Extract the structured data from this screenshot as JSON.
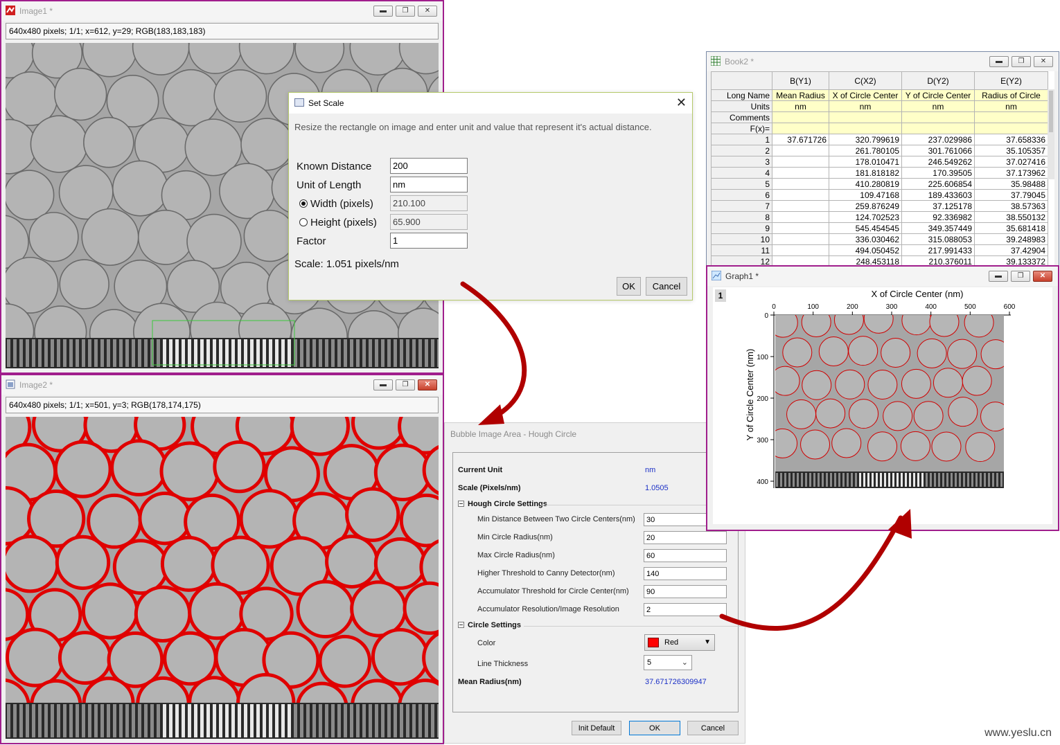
{
  "image1": {
    "title": "Image1 *",
    "status": "640x480 pixels; 1/1; x=612, y=29; RGB(183,183,183)"
  },
  "image2": {
    "title": "Image2 *",
    "status": "640x480 pixels; 1/1; x=501, y=3; RGB(178,174,175)"
  },
  "set_scale": {
    "title": "Set Scale",
    "description": "Resize the rectangle on image and enter unit and value that represent it's actual distance.",
    "known_distance_label": "Known Distance",
    "known_distance_value": "200",
    "unit_label": "Unit of Length",
    "unit_value": "nm",
    "width_label": "Width (pixels)",
    "width_value": "210.100",
    "width_selected": true,
    "height_label": "Height (pixels)",
    "height_value": "65.900",
    "factor_label": "Factor",
    "factor_value": "1",
    "scale_text": "Scale:  1.051 pixels/nm",
    "ok_label": "OK",
    "cancel_label": "Cancel"
  },
  "book": {
    "title": "Book2 *",
    "columns": [
      "B(Y1)",
      "C(X2)",
      "D(Y2)",
      "E(Y2)"
    ],
    "meta_rows": [
      {
        "label": "Long Name",
        "values": [
          "Mean Radius",
          "X of Circle Center",
          "Y of Circle Center",
          "Radius of Circle"
        ]
      },
      {
        "label": "Units",
        "values": [
          "nm",
          "nm",
          "nm",
          "nm"
        ]
      },
      {
        "label": "Comments",
        "values": [
          "",
          "",
          "",
          ""
        ]
      },
      {
        "label": "F(x)=",
        "values": [
          "",
          "",
          "",
          ""
        ]
      }
    ],
    "rows": [
      [
        "1",
        "37.671726",
        "320.799619",
        "237.029986",
        "37.658336"
      ],
      [
        "2",
        "",
        "261.780105",
        "301.761066",
        "35.105357"
      ],
      [
        "3",
        "",
        "178.010471",
        "246.549262",
        "37.027416"
      ],
      [
        "4",
        "",
        "181.818182",
        "170.39505",
        "37.173962"
      ],
      [
        "5",
        "",
        "410.280819",
        "225.606854",
        "35.98488"
      ],
      [
        "6",
        "",
        "109.47168",
        "189.433603",
        "37.79045"
      ],
      [
        "7",
        "",
        "259.876249",
        "37.125178",
        "38.57363"
      ],
      [
        "8",
        "",
        "124.702523",
        "92.336982",
        "38.550132"
      ],
      [
        "9",
        "",
        "545.454545",
        "349.357449",
        "35.681418"
      ],
      [
        "10",
        "",
        "336.030462",
        "315.088053",
        "39.248983"
      ],
      [
        "11",
        "",
        "494.050452",
        "217.991433",
        "37.42904"
      ],
      [
        "12",
        "",
        "248.453118",
        "210.376011",
        "39.133372"
      ]
    ]
  },
  "hough": {
    "title": "Bubble Image Area - Hough Circle",
    "current_unit_label": "Current Unit",
    "current_unit_value": "nm",
    "scale_label": "Scale (Pixels/nm)",
    "scale_value": "1.0505",
    "section1": "Hough Circle Settings",
    "fields": [
      {
        "label": "Min Distance Between Two Circle Centers(nm)",
        "value": "30"
      },
      {
        "label": "Min Circle Radius(nm)",
        "value": "20"
      },
      {
        "label": "Max Circle Radius(nm)",
        "value": "60"
      },
      {
        "label": "Higher Threshold to Canny Detector(nm)",
        "value": "140"
      },
      {
        "label": "Accumulator Threshold for Circle Center(nm)",
        "value": "90"
      },
      {
        "label": "Accumulator Resolution/Image Resolution",
        "value": "2"
      }
    ],
    "section2": "Circle Settings",
    "color_label": "Color",
    "color_value": "Red",
    "color_hex": "#ff0000",
    "thickness_label": "Line Thickness",
    "thickness_value": "5",
    "mean_radius_label": "Mean Radius(nm)",
    "mean_radius_value": "37.671726309947",
    "init_default_label": "Init Default",
    "ok_label": "OK",
    "cancel_label": "Cancel"
  },
  "graph": {
    "title": "Graph1 *",
    "layer": "1",
    "xlabel": "X of Circle Center (nm)",
    "ylabel": "Y of Circle Center (nm)",
    "xticks": [
      "0",
      "100",
      "200",
      "300",
      "400",
      "500",
      "600"
    ],
    "yticks": [
      "0",
      "100",
      "200",
      "300",
      "400"
    ]
  },
  "watermark": "www.yeslu.cn",
  "colors": {
    "window_border": "#a01e8c",
    "circle_red": "#e00000",
    "arrow": "#b00000"
  }
}
